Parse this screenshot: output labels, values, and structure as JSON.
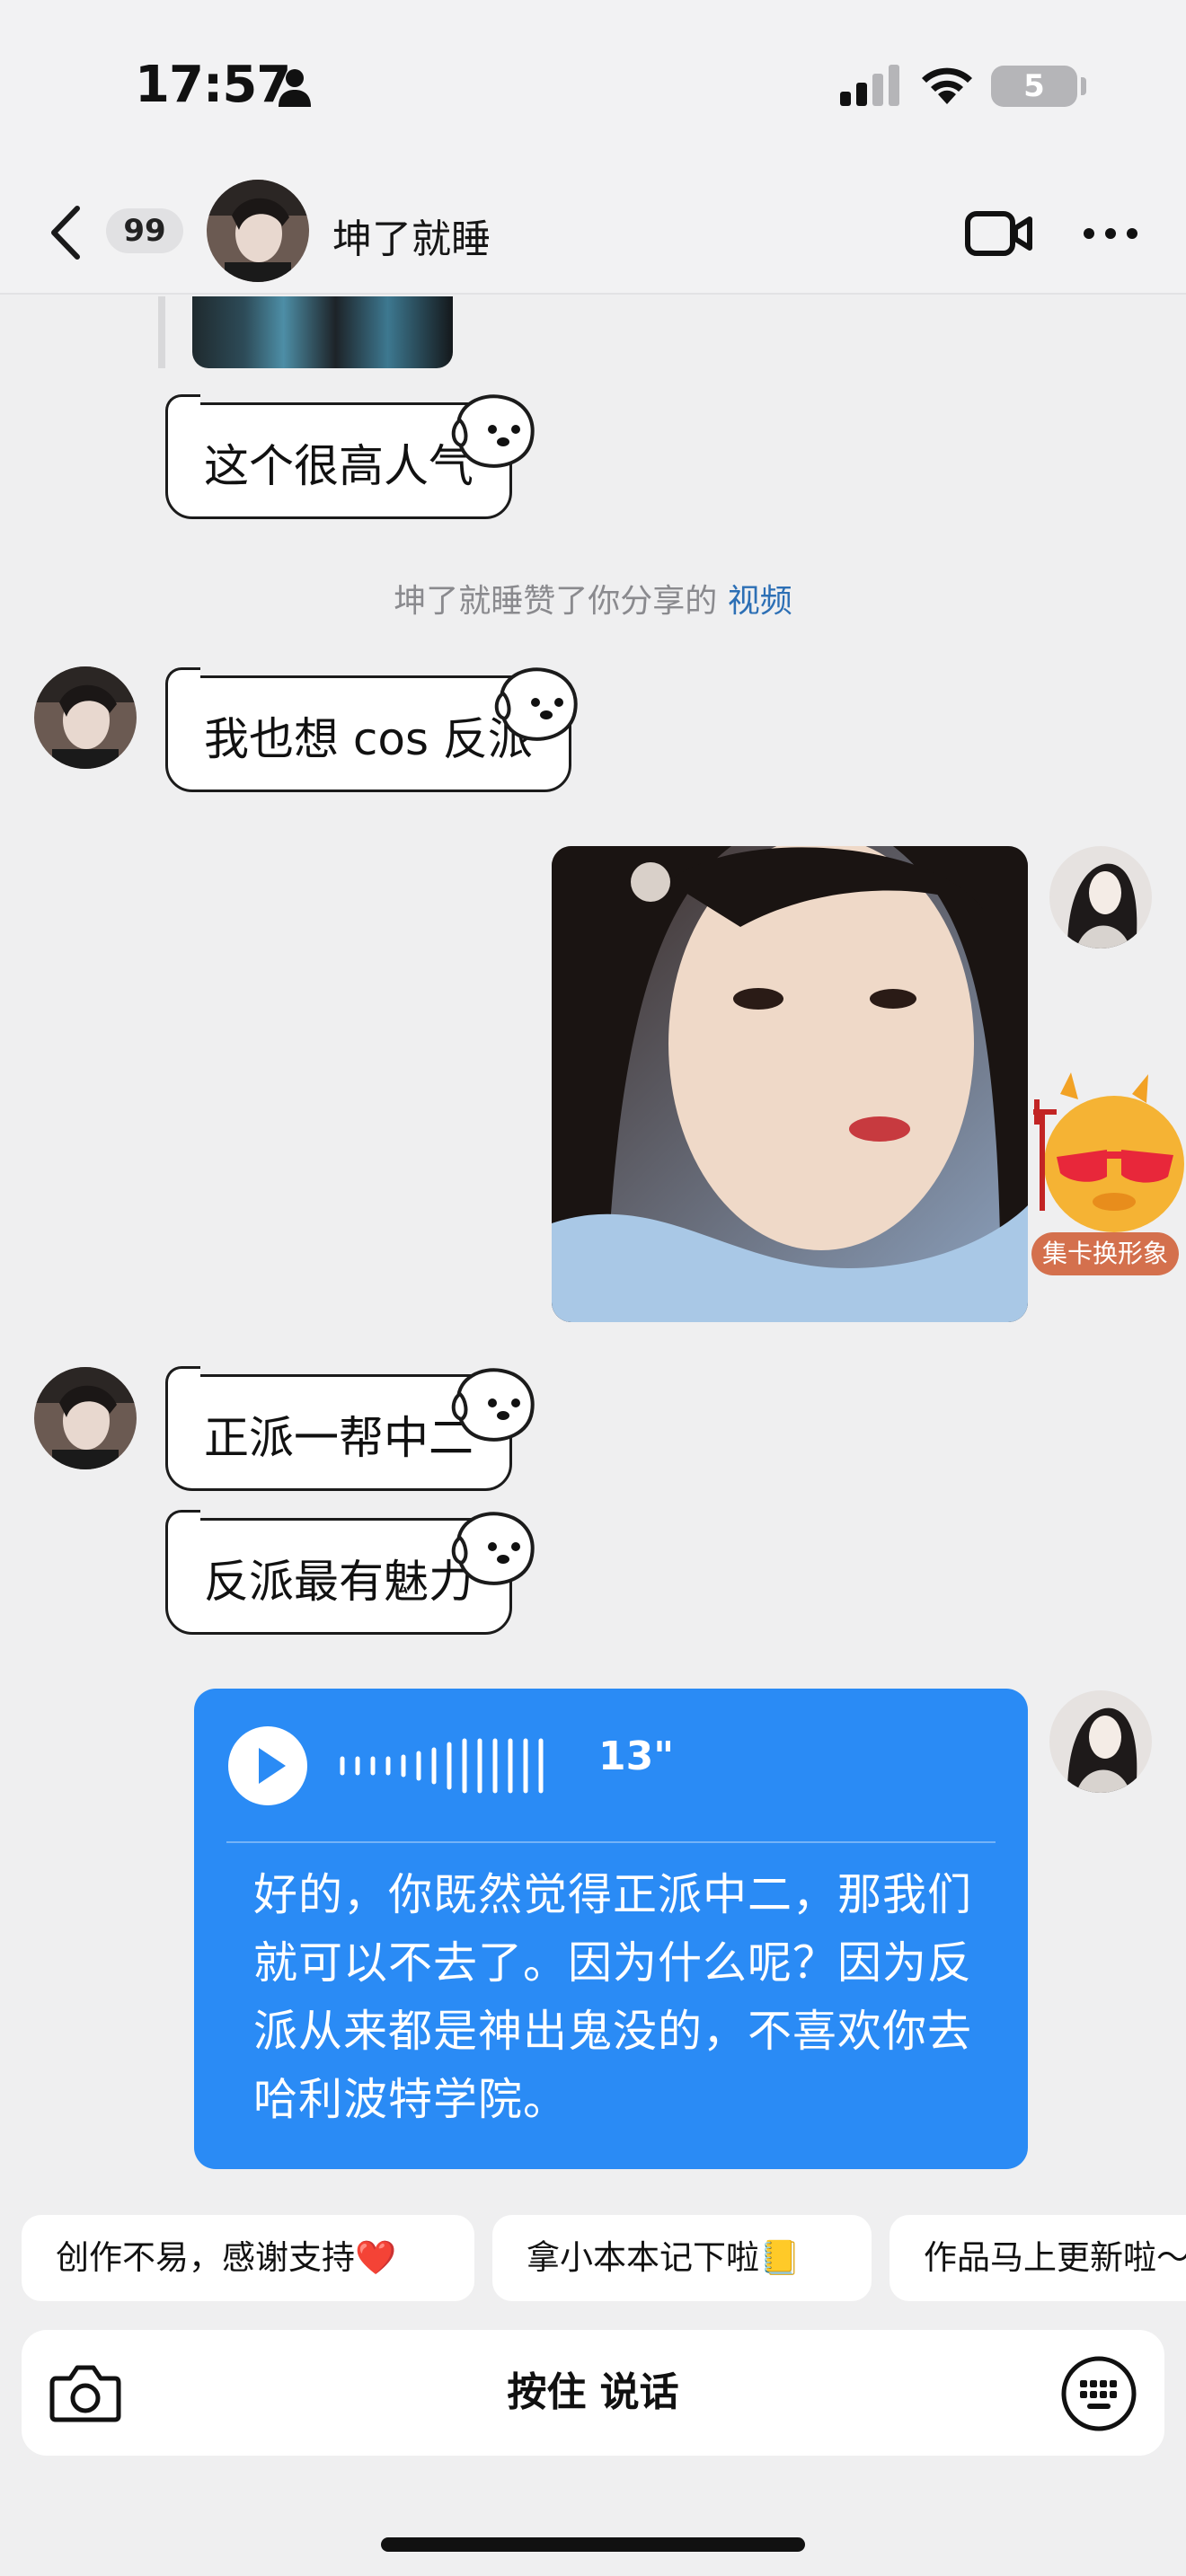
{
  "status_bar": {
    "time": "17:57",
    "battery_level": "5"
  },
  "nav": {
    "unread_count": "99",
    "contact_name": "坤了就睡"
  },
  "messages": {
    "bubble_1": "这个很高人气",
    "system_notice": "坤了就睡赞了你分享的",
    "system_link": "视频",
    "bubble_2": "我也想 cos 反派",
    "sticker_label": "集卡换形象",
    "bubble_3": "正派一帮中二",
    "bubble_4": "反派最有魅力",
    "voice": {
      "duration": "13\"",
      "transcript": "好的，你既然觉得正派中二，那我们就可以不去了。因为什么呢？因为反派从来都是神出鬼没的，不喜欢你去哈利波特学院。"
    }
  },
  "quick_replies": [
    "创作不易，感谢支持❤️",
    "拿小本本记下啦📒",
    "作品马上更新啦～"
  ],
  "input": {
    "hold_to_talk": "按住 说话"
  },
  "colors": {
    "accent_blue": "#2a8bf5",
    "link_blue": "#2c6fb5",
    "background": "#efeff0",
    "sticker_label": "#d4704d"
  }
}
